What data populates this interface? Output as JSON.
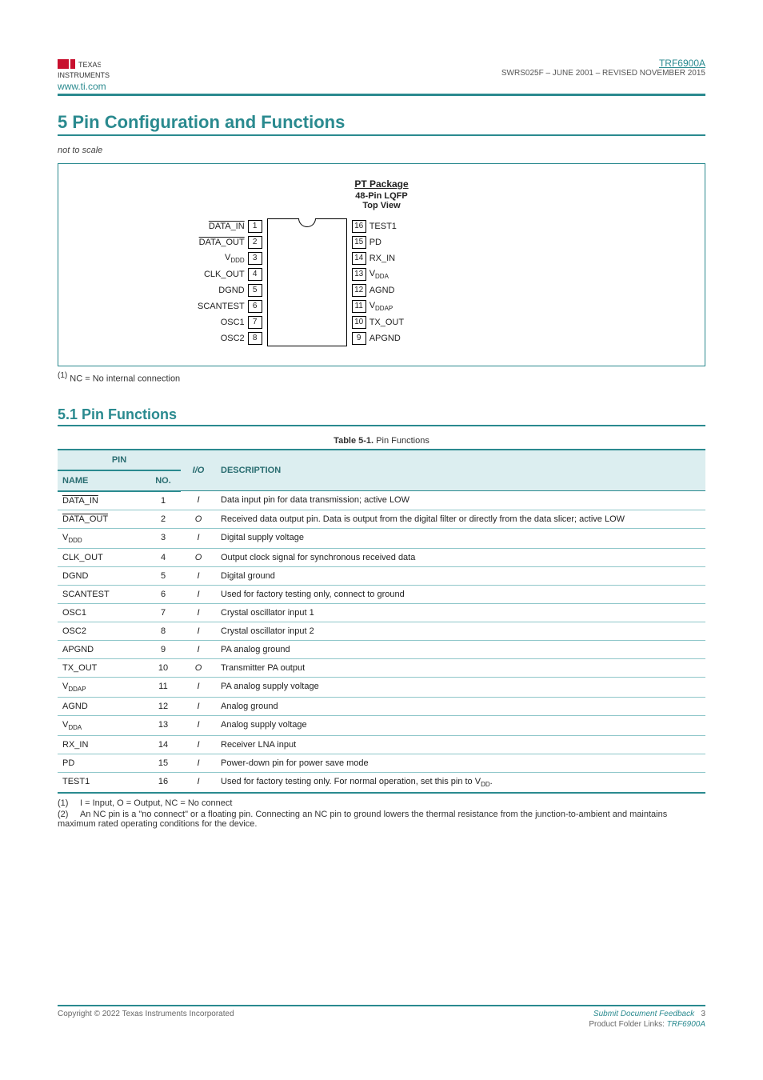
{
  "header": {
    "left_url": "www.ti.com",
    "right_part": "TRF6900A",
    "right_rev": "SWRS025F – JUNE 2001 – REVISED NOVEMBER 2015"
  },
  "section": {
    "num": "5",
    "title": "Pin Configuration and Functions",
    "sub_note_label": "not to scale"
  },
  "figure": {
    "title_pkg": "PT Package",
    "title_line2": "48-Pin LQFP",
    "title_view": "Top View",
    "left_pins": [
      {
        "label_html": "<span class='bar'>DATA_IN</span>",
        "num": "1"
      },
      {
        "label_html": "<span class='bar'>DATA_OUT</span>",
        "num": "2"
      },
      {
        "label_html": "V<sub>DDD</sub>",
        "num": "3"
      },
      {
        "label_html": "CLK_OUT",
        "num": "4"
      },
      {
        "label_html": "DGND",
        "num": "5"
      },
      {
        "label_html": "SCANTEST",
        "num": "6"
      },
      {
        "label_html": "OSC1",
        "num": "7"
      },
      {
        "label_html": "OSC2",
        "num": "8"
      }
    ],
    "right_pins": [
      {
        "num": "16",
        "label_html": "TEST1"
      },
      {
        "num": "15",
        "label_html": "PD"
      },
      {
        "num": "14",
        "label_html": "RX_IN"
      },
      {
        "num": "13",
        "label_html": "V<sub>DDA</sub>"
      },
      {
        "num": "12",
        "label_html": "AGND"
      },
      {
        "num": "11",
        "label_html": "V<sub>DDAP</sub>"
      },
      {
        "num": "10",
        "label_html": "TX_OUT"
      },
      {
        "num": "9",
        "label_html": "APGND"
      }
    ],
    "footnote_marker": "(1)",
    "footnote_text": "NC = No internal connection"
  },
  "pin_functions": {
    "heading": "5.1 Pin Functions",
    "table_title_prefix": "Table 5-1.",
    "table_title": "Pin Functions",
    "head": {
      "pin": "PIN",
      "name": "NAME",
      "no": "NO.",
      "io": "I/O",
      "desc": "DESCRIPTION"
    },
    "rows": [
      {
        "name_html": "<span class='bar'>DATA_IN</span>",
        "no": "1",
        "io": "I",
        "desc": "Data input pin for data transmission; active LOW"
      },
      {
        "name_html": "<span class='bar'>DATA_OUT</span>",
        "no": "2",
        "io": "O",
        "desc": "Received data output pin. Data is output from the digital filter or directly from the data slicer; active LOW"
      },
      {
        "name_html": "V<sub>DDD</sub>",
        "no": "3",
        "io": "I",
        "desc": "Digital supply voltage"
      },
      {
        "name_html": "CLK_OUT",
        "no": "4",
        "io": "O",
        "desc": "Output clock signal for synchronous received data"
      },
      {
        "name_html": "DGND",
        "no": "5",
        "io": "I",
        "desc": "Digital ground"
      },
      {
        "name_html": "SCANTEST",
        "no": "6",
        "io": "I",
        "desc": "Used for factory testing only, connect to ground"
      },
      {
        "name_html": "OSC1",
        "no": "7",
        "io": "I",
        "desc": "Crystal oscillator input 1"
      },
      {
        "name_html": "OSC2",
        "no": "8",
        "io": "I",
        "desc": "Crystal oscillator input 2"
      },
      {
        "name_html": "APGND",
        "no": "9",
        "io": "I",
        "desc": "PA analog ground"
      },
      {
        "name_html": "TX_OUT",
        "no": "10",
        "io": "O",
        "desc": "Transmitter PA output"
      },
      {
        "name_html": "V<sub>DDAP</sub>",
        "no": "11",
        "io": "I",
        "desc": "PA analog supply voltage"
      },
      {
        "name_html": "AGND",
        "no": "12",
        "io": "I",
        "desc": "Analog ground"
      },
      {
        "name_html": "V<sub>DDA</sub>",
        "no": "13",
        "io": "I",
        "desc": "Analog supply voltage"
      },
      {
        "name_html": "RX_IN",
        "no": "14",
        "io": "I",
        "desc": "Receiver LNA input"
      },
      {
        "name_html": "PD",
        "no": "15",
        "io": "I",
        "desc": "Power-down pin for power save mode"
      },
      {
        "name_html": "TEST1",
        "no": "16",
        "io": "I",
        "desc": "Used for factory testing only. For normal operation, set this pin to V<sub>DD</sub>."
      }
    ],
    "footnotes": [
      {
        "marker": "(1)",
        "text": "I = Input, O = Output, NC = No connect"
      },
      {
        "marker": "(2)",
        "text": "An NC pin is a \"no connect\" or a floating pin. Connecting an NC pin to ground lowers the thermal resistance from the junction-to-ambient and maintains maximum rated operating conditions for the device."
      }
    ]
  },
  "footer": {
    "copyright": "Copyright © 2022 Texas Instruments Incorporated",
    "feedback": "Submit Document Feedback",
    "page": "3",
    "rights": "Product Folder Links:",
    "prod": "TRF6900A"
  }
}
